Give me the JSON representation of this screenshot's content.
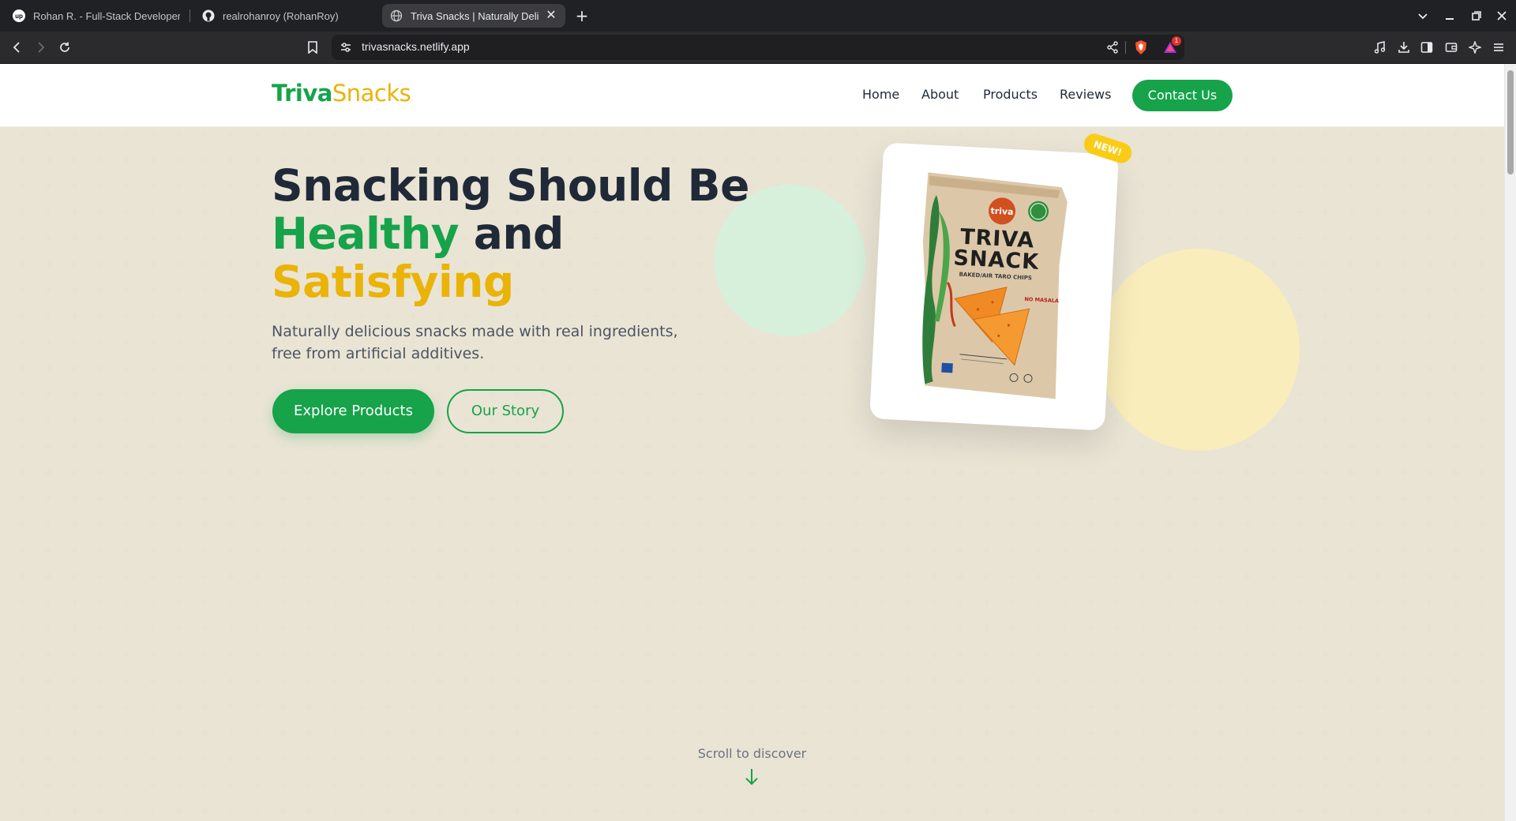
{
  "browser": {
    "tabs": [
      {
        "title": "Rohan R. - Full-Stack Developer (",
        "favicon": "upwork-icon"
      },
      {
        "title": "realrohanroy (RohanRoy)",
        "favicon": "github-icon"
      },
      {
        "title": "Triva Snacks | Naturally Delic",
        "favicon": "globe-icon",
        "active": true
      }
    ],
    "new_tab_symbol": "+",
    "url": "trivasnacks.netlify.app",
    "brave_shield_badge": "1"
  },
  "site": {
    "logo": {
      "part1": "Triva",
      "part2": "Snacks"
    },
    "nav": {
      "home": "Home",
      "about": "About",
      "products": "Products",
      "reviews": "Reviews",
      "contact": "Contact Us"
    },
    "hero": {
      "line1": "Snacking Should Be",
      "line2_green": "Healthy",
      "line2_rest": " and",
      "line3_yellow": "Satisfying",
      "subtext": "Naturally delicious snacks made with real ingredients, free from artificial additives.",
      "primary_button": "Explore Products",
      "secondary_button": "Our Story"
    },
    "product": {
      "badge": "NEW!",
      "bag_brand_logo": "triva",
      "bag_title_line1": "TRIVA",
      "bag_title_line2": "SNACK",
      "bag_subtitle": "BAKED/AIR TARO CHIPS",
      "bag_flavor": "NO MASALA"
    },
    "scroll_hint": "Scroll to discover"
  },
  "colors": {
    "brand_green": "#16a34a",
    "brand_yellow": "#eab308",
    "page_background": "#fdfcf6",
    "heading": "#1f2937"
  }
}
